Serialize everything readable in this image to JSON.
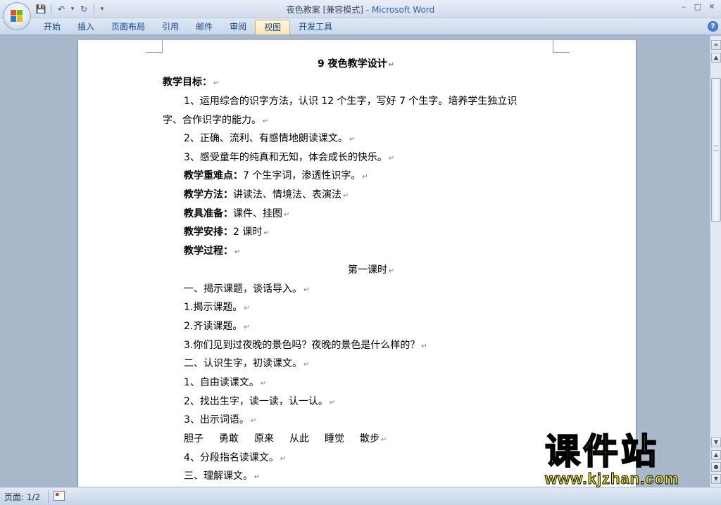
{
  "window": {
    "title_doc": "夜色教案 [兼容模式]",
    "title_sep": " - ",
    "title_app": "Microsoft Word",
    "controls": [
      "–",
      "□",
      "✕"
    ]
  },
  "qat": {
    "save": "💾",
    "undo": "↶",
    "dropdown": "▾",
    "redo": "↻",
    "more": "▾"
  },
  "ribbon": {
    "tabs": [
      "开始",
      "插入",
      "页面布局",
      "引用",
      "邮件",
      "审阅",
      "视图",
      "开发工具"
    ],
    "active_tab": "视图",
    "help": "?"
  },
  "document": {
    "pm": "↵",
    "title": "9 夜色教学设计",
    "lines": {
      "goals_label": "教学目标：",
      "g1a": "1、运用综合的识字方法，认识 12 个生字，写好 7 个生字。培养学生独立识",
      "g1b": "字、合作识字的能力。",
      "g2": "2、正确、流利、有感情地朗读课文。",
      "g3": "3、感受童年的纯真和无知，体会成长的快乐。",
      "key_label": "教学重难点：",
      "key_text": "7 个生字词，渗透性识字。",
      "method_label": "教学方法：",
      "method_text": "讲读法、情境法、表演法",
      "prep_label": "教具准备：",
      "prep_text": "课件、挂图",
      "sched_label": "教学安排：",
      "sched_text": "2 课时",
      "proc_label": "教学过程：",
      "lesson1": "第一课时",
      "s1": "一、揭示课题，谈话导入。",
      "s1_1": "1.揭示课题。",
      "s1_2": "2.齐读课题。",
      "s1_3": "3.你们见到过夜晚的景色吗？夜晚的景色是什么样的？",
      "s2": "二、认识生字，初读课文。",
      "s2_1": "1、自由读课文。",
      "s2_2": "2、找出生字，读一读，认一认。",
      "s2_3": "3、出示词语。",
      "s2_4": "4、分段指名读课文。",
      "s3": "三、理解课文。"
    },
    "vocab": [
      "胆子",
      "勇敢",
      "原来",
      "从此",
      "睡觉",
      "散步"
    ]
  },
  "status": {
    "page": "页面: 1/2"
  },
  "watermark": {
    "cn": "课件站",
    "url": "www.kjzhan.com"
  },
  "colors": {
    "accent": "#15428b",
    "watermark": "#f2f000"
  }
}
